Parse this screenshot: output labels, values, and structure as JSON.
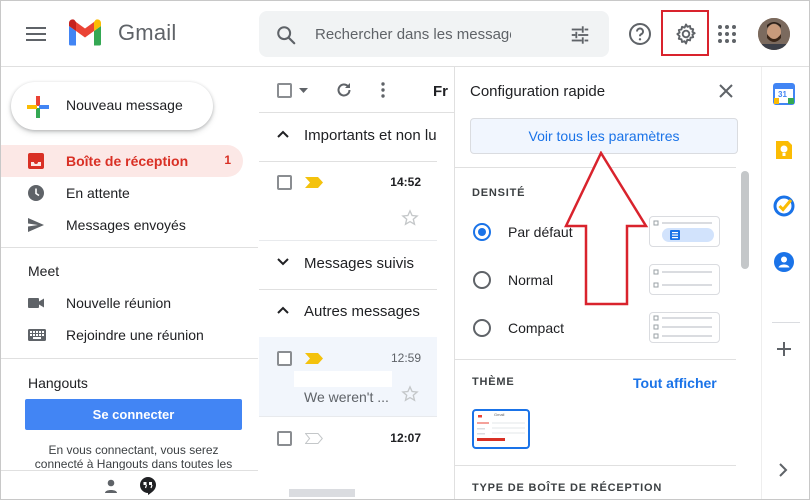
{
  "header": {
    "brand": "Gmail",
    "search_placeholder": "Rechercher dans les messages"
  },
  "sidebar": {
    "compose_label": "Nouveau message",
    "items": [
      {
        "label": "Boîte de réception",
        "count": "1",
        "active": true
      },
      {
        "label": "En attente"
      },
      {
        "label": "Messages envoyés"
      }
    ],
    "meet": {
      "title": "Meet",
      "items": [
        {
          "label": "Nouvelle réunion"
        },
        {
          "label": "Rejoindre une réunion"
        }
      ]
    },
    "hangouts": {
      "title": "Hangouts",
      "connect_label": "Se connecter",
      "note": "En vous connectant, vous serez connecté à Hangouts dans toutes les"
    }
  },
  "list": {
    "toolbar_partial_label": "Fr",
    "groups": [
      {
        "label": "Importants et non lus"
      },
      {
        "label": "Messages suivis"
      },
      {
        "label": "Autres messages"
      }
    ],
    "rows": [
      {
        "time": "14:52",
        "bold": true,
        "snippet": ""
      },
      {
        "time": "12:59",
        "bold": false,
        "snippet": "We weren't ..."
      },
      {
        "time": "12:07",
        "bold": true,
        "snippet": ""
      }
    ]
  },
  "quick_settings": {
    "title": "Configuration rapide",
    "see_all": "Voir tous les paramètres",
    "density_caption": "DENSITÉ",
    "density_options": [
      {
        "label": "Par défaut",
        "selected": true
      },
      {
        "label": "Normal",
        "selected": false
      },
      {
        "label": "Compact",
        "selected": false
      }
    ],
    "theme_caption": "THÈME",
    "theme_show_all": "Tout afficher",
    "theme_thumb_brand": "Gmail",
    "inbox_type_caption": "TYPE DE BOÎTE DE RÉCEPTION"
  },
  "right_rail": {
    "icons": [
      "calendar-icon",
      "keep-icon",
      "tasks-icon",
      "contacts-icon",
      "add-icon",
      "expand-icon"
    ],
    "calendar_day": "31"
  },
  "colors": {
    "accent": "#1a73e8",
    "highlight_box": "#d9232d",
    "active_nav_bg": "#fce8e6",
    "important_marker": "#f4c20d"
  }
}
